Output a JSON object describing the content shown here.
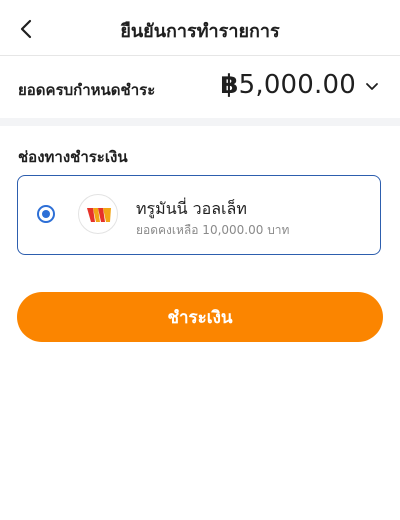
{
  "header": {
    "title": "ยืนยันการทำรายการ",
    "back_icon": "chevron-left-icon"
  },
  "amount": {
    "label": "ยอดครบกำหนดชำระ",
    "currency_symbol": "฿",
    "value": "5,000.00",
    "dropdown_icon": "chevron-down-icon"
  },
  "payment_channel": {
    "section_label": "ช่องทางชำระเงิน",
    "selected": true,
    "name": "ทรูมันนี่ วอลเล็ท",
    "balance_text": "ยอดคงเหลือ 10,000.00 บาท",
    "logo_icon": "truemoney-wallet-logo"
  },
  "actions": {
    "pay_label": "ชำระเงิน"
  },
  "colors": {
    "accent_orange": "#fb8500",
    "selection_blue": "#2d6fd6",
    "card_border": "#2d5eae"
  }
}
